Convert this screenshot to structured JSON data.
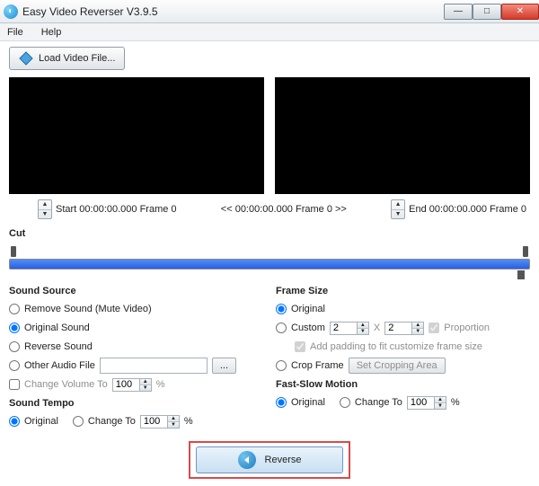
{
  "titlebar": {
    "title": "Easy Video Reverser V3.9.5"
  },
  "menu": {
    "file": "File",
    "help": "Help"
  },
  "toolbar": {
    "load_label": "Load Video File..."
  },
  "preview": {
    "start_label": "Start 00:00:00.000 Frame 0",
    "mid_label": "<< 00:00:00.000  Frame 0 >>",
    "end_label": "End 00:00:00.000  Frame 0"
  },
  "cut": {
    "title": "Cut"
  },
  "sound": {
    "title": "Sound Source",
    "opt_remove": "Remove Sound (Mute Video)",
    "opt_original": "Original Sound",
    "opt_reverse": "Reverse Sound",
    "opt_other": "Other Audio File",
    "browse": "...",
    "change_volume": "Change Volume To",
    "volume_value": "100",
    "percent": "%"
  },
  "tempo": {
    "title": "Sound Tempo",
    "opt_original": "Original",
    "opt_change": "Change To",
    "value": "100",
    "percent": "%"
  },
  "frame": {
    "title": "Frame Size",
    "opt_original": "Original",
    "opt_custom": "Custom",
    "w": "2",
    "h": "2",
    "x": "X",
    "proportion": "Proportion",
    "padding": "Add padding to fit customize frame size",
    "opt_crop": "Crop Frame",
    "crop_btn": "Set Cropping Area"
  },
  "motion": {
    "title": "Fast-Slow Motion",
    "opt_original": "Original",
    "opt_change": "Change To",
    "value": "100",
    "percent": "%"
  },
  "reverse": {
    "label": "Reverse"
  }
}
